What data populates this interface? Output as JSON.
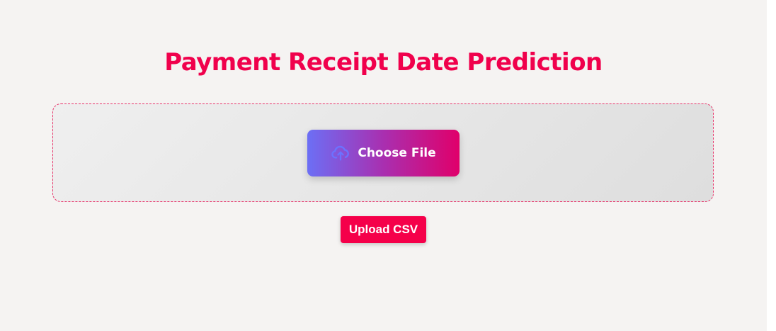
{
  "page": {
    "title": "Payment Receipt Date Prediction"
  },
  "file_picker": {
    "label": "Choose File",
    "icon": "cloud-upload-icon"
  },
  "upload": {
    "label": "Upload CSV"
  },
  "colors": {
    "accent": "#f0004c",
    "background": "#f5f3f2",
    "gradient_start": "#6c6ff5",
    "gradient_end": "#e0006a"
  }
}
